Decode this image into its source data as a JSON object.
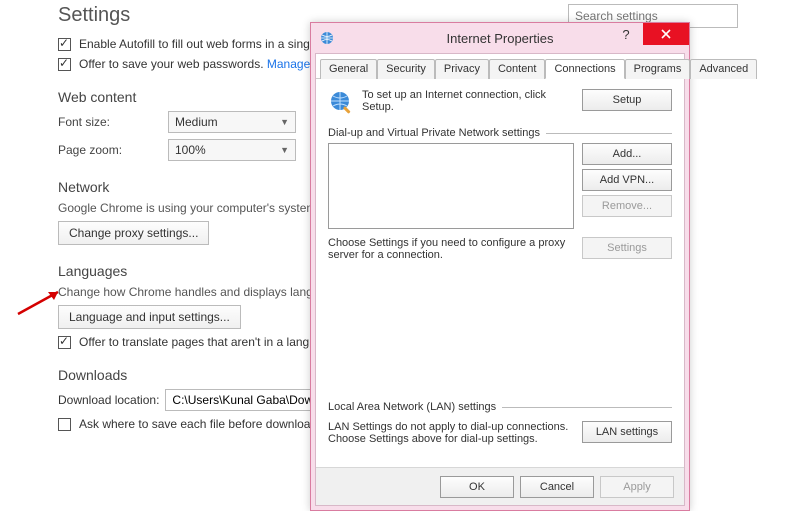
{
  "settings": {
    "title": "Settings",
    "search_placeholder": "Search settings",
    "autofill_label": "Enable Autofill to fill out web forms in a singl",
    "save_pw_label": "Offer to save your web passwords.",
    "manage_pw_link": "Manage p",
    "web_content_head": "Web content",
    "font_size_label": "Font size:",
    "font_size_value": "Medium",
    "page_zoom_label": "Page zoom:",
    "page_zoom_value": "100%",
    "network_head": "Network",
    "network_desc": "Google Chrome is using your computer's system",
    "change_proxy_btn": "Change proxy settings...",
    "languages_head": "Languages",
    "languages_desc": "Change how Chrome handles and displays langua",
    "language_btn": "Language and input settings...",
    "translate_label": "Offer to translate pages that aren't in a langu",
    "downloads_head": "Downloads",
    "download_loc_label": "Download location:",
    "download_loc_value": "C:\\Users\\Kunal Gaba\\Downlo",
    "ask_save_label": "Ask where to save each file before downloadi"
  },
  "dialog": {
    "title": "Internet Properties",
    "tabs": [
      "General",
      "Security",
      "Privacy",
      "Content",
      "Connections",
      "Programs",
      "Advanced"
    ],
    "active_tab": "Connections",
    "setup_text": "To set up an Internet connection, click Setup.",
    "setup_btn": "Setup",
    "dun_group": "Dial-up and Virtual Private Network settings",
    "add_btn": "Add...",
    "add_vpn_btn": "Add VPN...",
    "remove_btn": "Remove...",
    "dun_note": "Choose Settings if you need to configure a proxy server for a connection.",
    "dun_settings_btn": "Settings",
    "lan_group": "Local Area Network (LAN) settings",
    "lan_note": "LAN Settings do not apply to dial-up connections. Choose Settings above for dial-up settings.",
    "lan_btn": "LAN settings",
    "ok_btn": "OK",
    "cancel_btn": "Cancel",
    "apply_btn": "Apply"
  }
}
